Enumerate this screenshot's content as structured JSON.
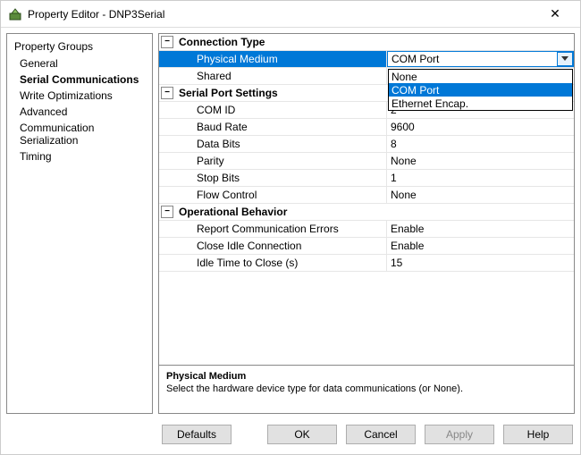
{
  "window": {
    "title": "Property Editor - DNP3Serial"
  },
  "sidebar": {
    "header": "Property Groups",
    "items": [
      {
        "label": "General"
      },
      {
        "label": "Serial Communications",
        "bold": true
      },
      {
        "label": "Write Optimizations"
      },
      {
        "label": "Advanced"
      },
      {
        "label": "Communication Serialization"
      },
      {
        "label": "Timing"
      }
    ]
  },
  "sections": {
    "connection": {
      "title": "Connection Type",
      "physical_medium": {
        "label": "Physical Medium",
        "value": "COM Port"
      },
      "shared": {
        "label": "Shared",
        "value": ""
      }
    },
    "serial": {
      "title": "Serial Port Settings",
      "com_id": {
        "label": "COM ID",
        "value": "2"
      },
      "baud": {
        "label": "Baud Rate",
        "value": "9600"
      },
      "data_bits": {
        "label": "Data Bits",
        "value": "8"
      },
      "parity": {
        "label": "Parity",
        "value": "None"
      },
      "stop_bits": {
        "label": "Stop Bits",
        "value": "1"
      },
      "flow": {
        "label": "Flow Control",
        "value": "None"
      }
    },
    "op": {
      "title": "Operational Behavior",
      "report_err": {
        "label": "Report Communication Errors",
        "value": "Enable"
      },
      "close_idle": {
        "label": "Close Idle Connection",
        "value": "Enable"
      },
      "idle_time": {
        "label": "Idle Time to Close (s)",
        "value": "15"
      }
    }
  },
  "dropdown": {
    "options": [
      "None",
      "COM Port",
      "Ethernet Encap."
    ],
    "selected_index": 1
  },
  "help": {
    "title": "Physical Medium",
    "text": "Select the hardware device type for data communications (or None)."
  },
  "buttons": {
    "defaults": "Defaults",
    "ok": "OK",
    "cancel": "Cancel",
    "apply": "Apply",
    "help": "Help"
  }
}
